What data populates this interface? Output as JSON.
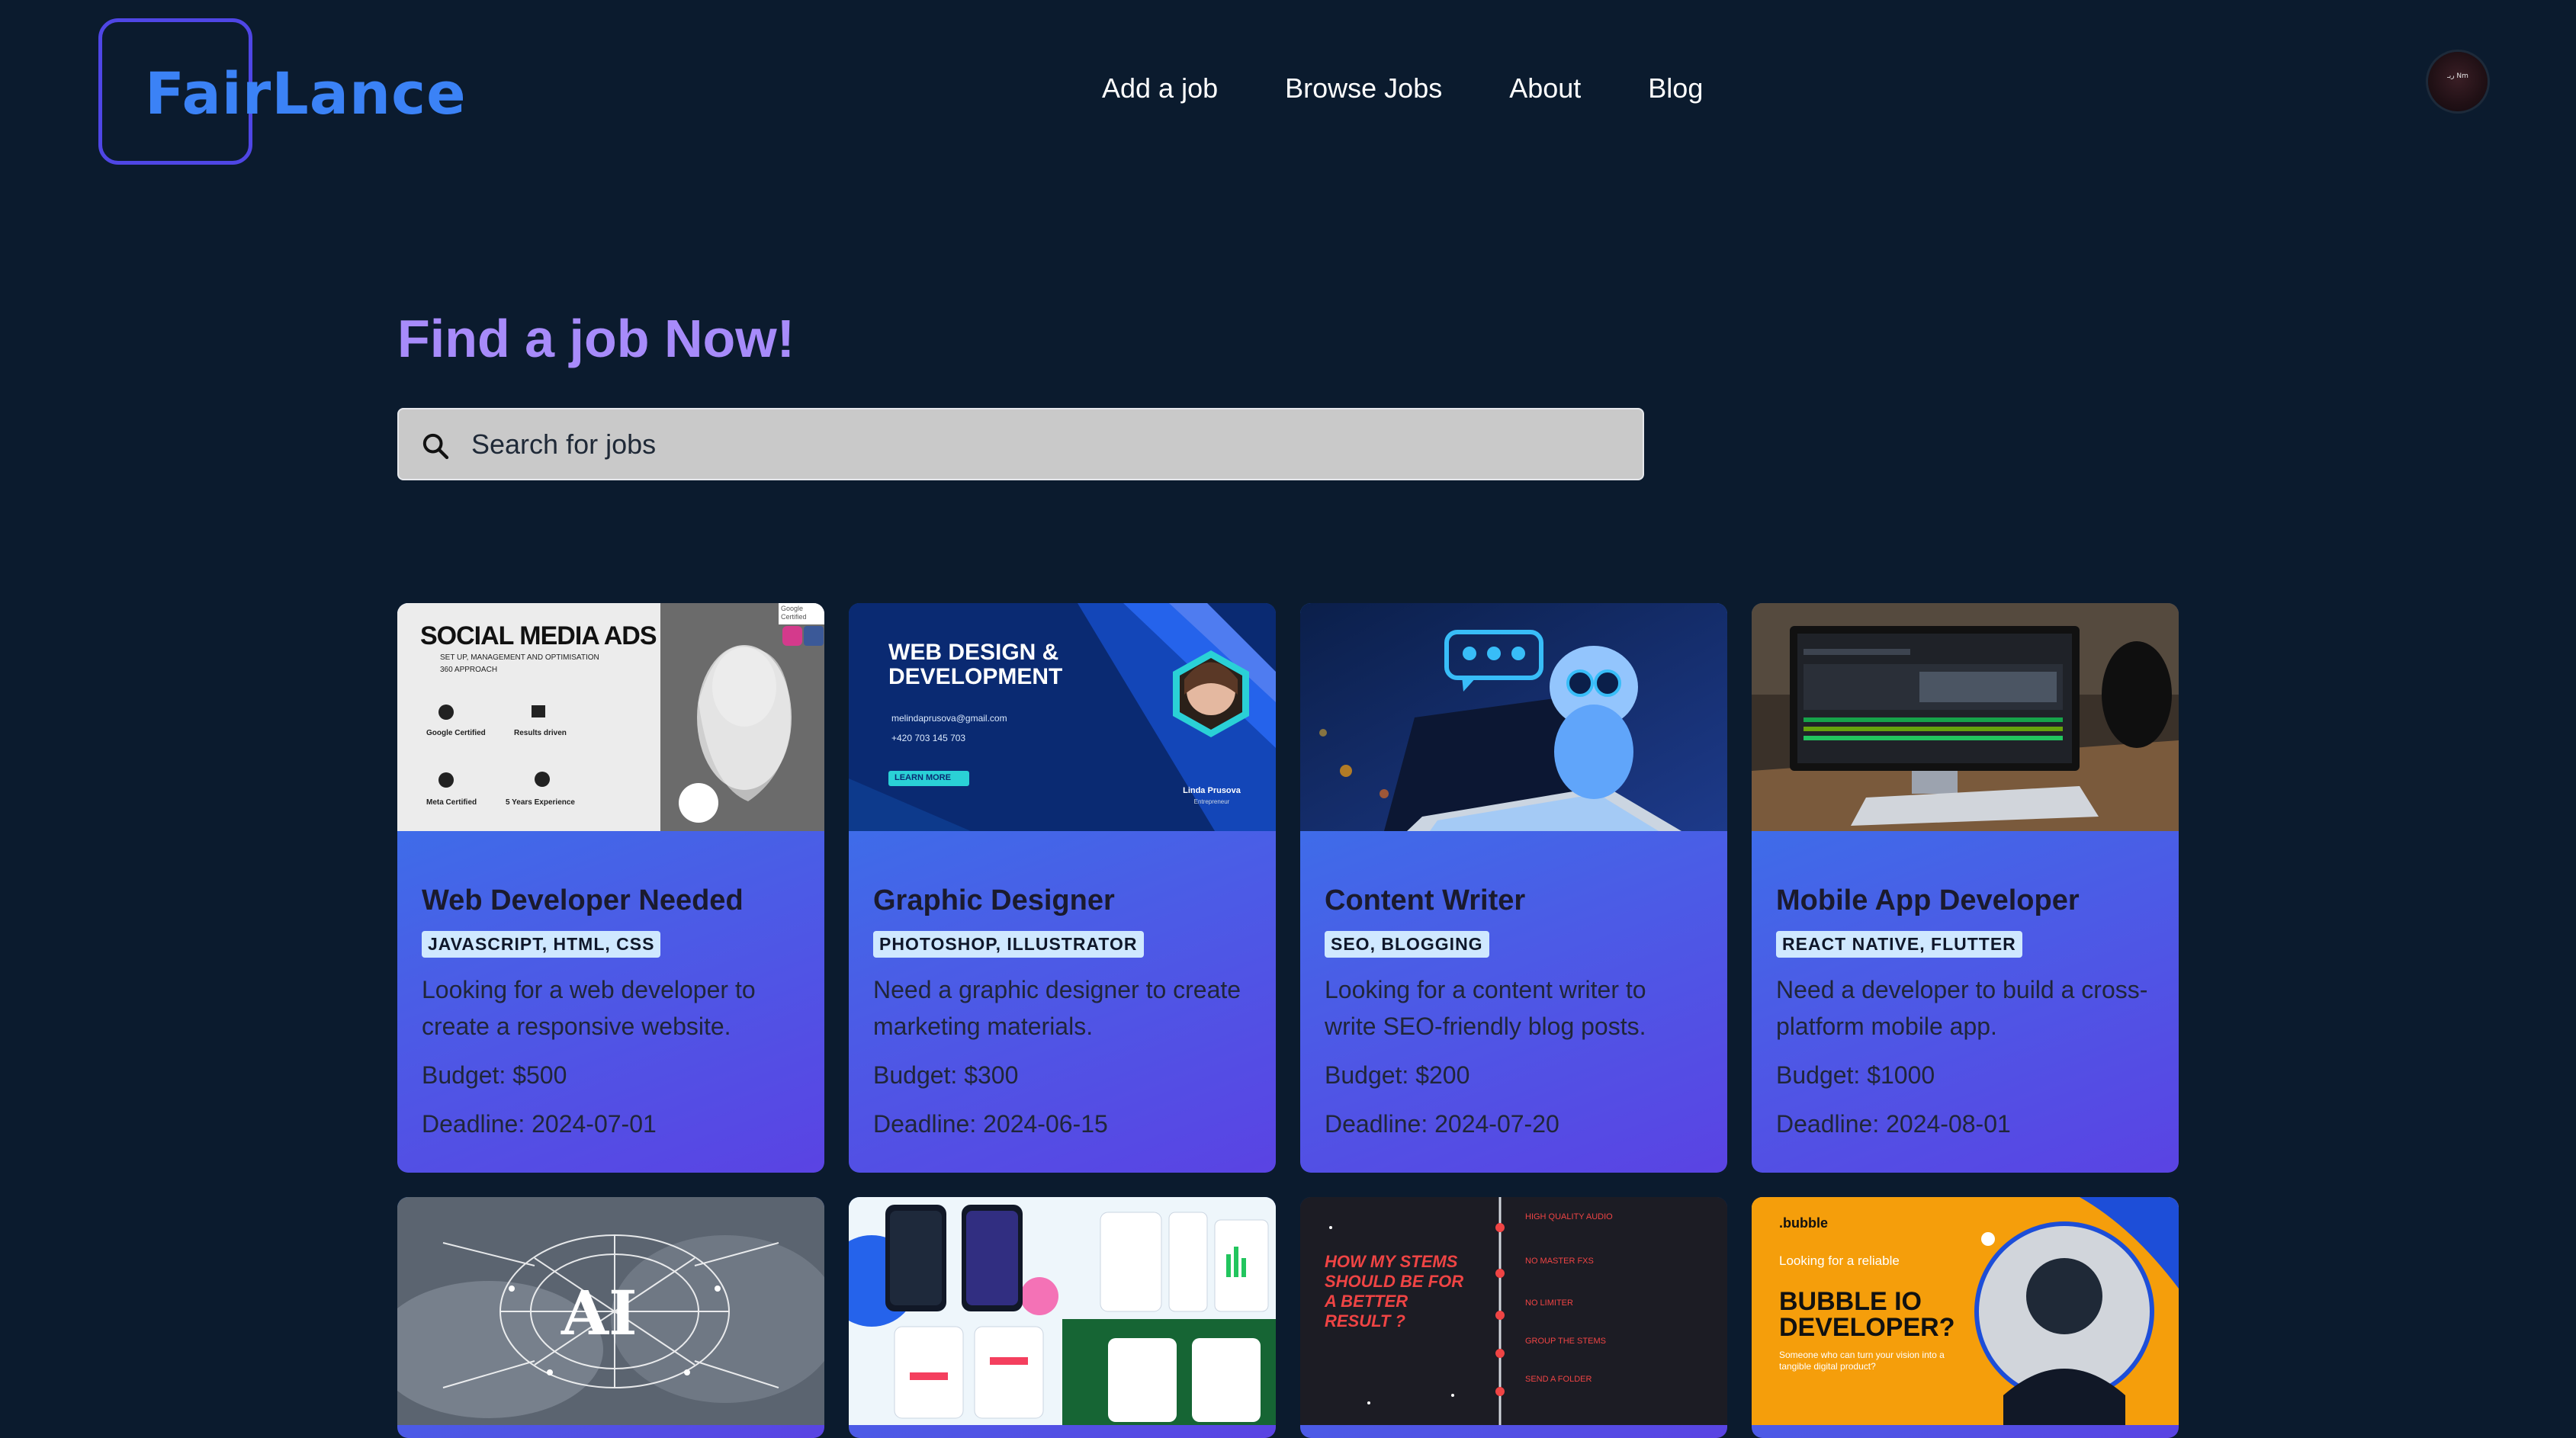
{
  "brand": {
    "name": "FairLance"
  },
  "nav": [
    "Add a job",
    "Browse Jobs",
    "About",
    "Blog"
  ],
  "avatar": {
    "label": "ربـ Nm"
  },
  "hero": {
    "title": "Find a job Now!"
  },
  "search": {
    "placeholder": "Search for jobs"
  },
  "colors": {
    "background": "#0b1b2e",
    "logo_border": "#4f46e5",
    "logo_text": "#3b82f6",
    "title": "#a78bfa",
    "card_gradient_start": "#2f80ed",
    "card_gradient_end": "#5a43e3",
    "tag_bg": "#cfe8ff"
  },
  "jobs": [
    {
      "title": "Web Developer Needed",
      "tags": "JAVASCRIPT, HTML, CSS",
      "description": "Looking for a web developer to create a responsive website.",
      "budget": "Budget: $500",
      "deadline": "Deadline: 2024-07-01",
      "thumb": {
        "heading": "SOCIAL MEDIA ADS",
        "bullets": [
          "SET UP, MANAGEMENT AND OPTIMISATION",
          "360 APPROACH"
        ],
        "badges": [
          "Google Certified",
          "Results driven",
          "Meta Certified",
          "5 Years Experience"
        ],
        "corner": "Google Certified"
      }
    },
    {
      "title": "Graphic Designer",
      "tags": "PHOTOSHOP, ILLUSTRATOR",
      "description": "Need a graphic designer to create marketing materials.",
      "budget": "Budget: $300",
      "deadline": "Deadline: 2024-06-15",
      "thumb": {
        "line1": "WEB DESIGN &",
        "line2": "DEVELOPMENT",
        "email": "melindaprusova@gmail.com",
        "phone": "+420 703 145 703",
        "button": "LEARN MORE",
        "name": "Linda Prusova",
        "role": "Entrepreneur"
      }
    },
    {
      "title": "Content Writer",
      "tags": "SEO, BLOGGING",
      "description": "Looking for a content writer to write SEO-friendly blog posts.",
      "budget": "Budget: $200",
      "deadline": "Deadline: 2024-07-20"
    },
    {
      "title": "Mobile App Developer",
      "tags": "REACT NATIVE, FLUTTER",
      "description": "Need a developer to build a cross-platform mobile app.",
      "budget": "Budget: $1000",
      "deadline": "Deadline: 2024-08-01"
    }
  ],
  "row2_thumbs": [
    {
      "text": "AI"
    },
    {
      "text": ""
    },
    {
      "text": "HOW MY STEMS SHOULD BE FOR A BETTER RESULT ?",
      "items": [
        "HIGH QUALITY AUDIO",
        "NO MASTER FXS",
        "NO LIMITER",
        "GROUP THE STEMS",
        "SEND A FOLDER"
      ]
    },
    {
      "brand": ".bubble",
      "sub": "Looking for a reliable",
      "headline1": "BUBBLE IO",
      "headline2": "DEVELOPER?",
      "tagline": "Someone who can turn your vision into a tangible digital product?"
    }
  ]
}
